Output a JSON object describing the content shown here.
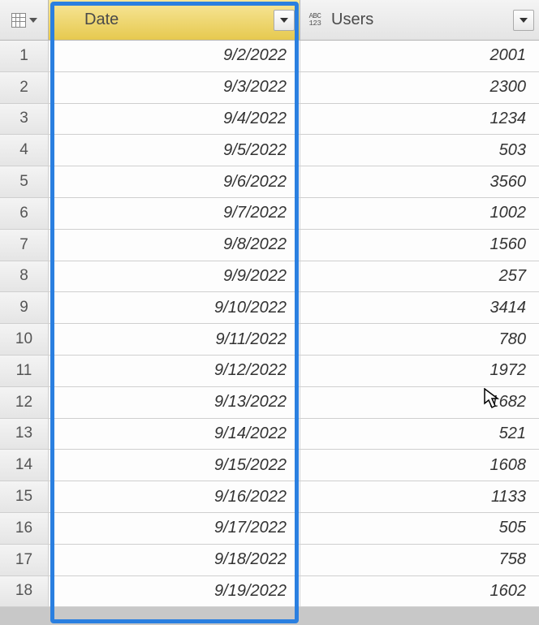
{
  "columns": {
    "rownum_type_icon": "table-icon",
    "date": {
      "label": "Date",
      "icon": "table-icon"
    },
    "users": {
      "label": "Users",
      "dtype_top": "ABC",
      "dtype_bottom": "123"
    }
  },
  "rows": [
    {
      "n": "1",
      "date": "9/2/2022",
      "users": "2001"
    },
    {
      "n": "2",
      "date": "9/3/2022",
      "users": "2300"
    },
    {
      "n": "3",
      "date": "9/4/2022",
      "users": "1234"
    },
    {
      "n": "4",
      "date": "9/5/2022",
      "users": "503"
    },
    {
      "n": "5",
      "date": "9/6/2022",
      "users": "3560"
    },
    {
      "n": "6",
      "date": "9/7/2022",
      "users": "1002"
    },
    {
      "n": "7",
      "date": "9/8/2022",
      "users": "1560"
    },
    {
      "n": "8",
      "date": "9/9/2022",
      "users": "257"
    },
    {
      "n": "9",
      "date": "9/10/2022",
      "users": "3414"
    },
    {
      "n": "10",
      "date": "9/11/2022",
      "users": "780"
    },
    {
      "n": "11",
      "date": "9/12/2022",
      "users": "1972"
    },
    {
      "n": "12",
      "date": "9/13/2022",
      "users": "1682"
    },
    {
      "n": "13",
      "date": "9/14/2022",
      "users": "521"
    },
    {
      "n": "14",
      "date": "9/15/2022",
      "users": "1608"
    },
    {
      "n": "15",
      "date": "9/16/2022",
      "users": "1133"
    },
    {
      "n": "16",
      "date": "9/17/2022",
      "users": "505"
    },
    {
      "n": "17",
      "date": "9/18/2022",
      "users": "758"
    },
    {
      "n": "18",
      "date": "9/19/2022",
      "users": "1602"
    }
  ],
  "selection": {
    "column": "date"
  }
}
